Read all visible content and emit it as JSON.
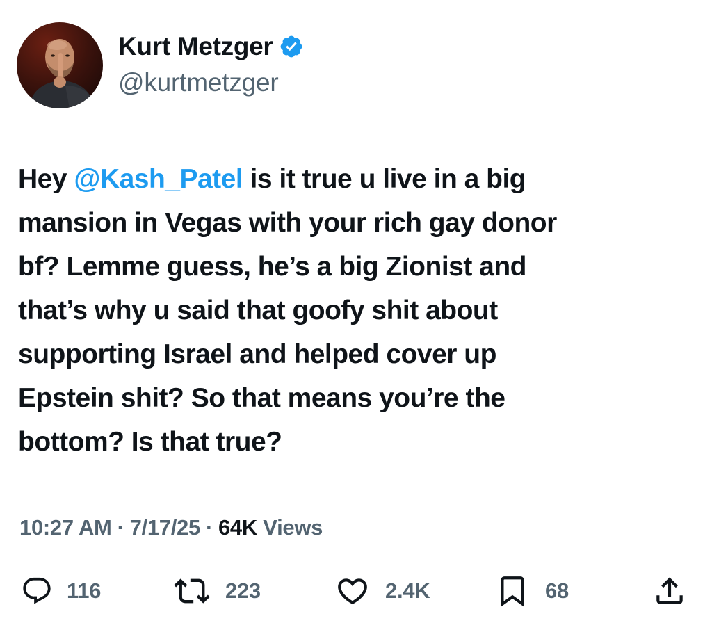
{
  "author": {
    "display_name": "Kurt Metzger",
    "handle": "@kurtmetzger",
    "verified": true,
    "verified_icon": "verified-badge-icon",
    "verified_color": "#1d9bf0"
  },
  "tweet": {
    "text_segments": [
      {
        "type": "text",
        "value": "Hey "
      },
      {
        "type": "mention",
        "value": "@Kash_Patel"
      },
      {
        "type": "text",
        "value": " is it true u live in a big\nmansion in Vegas with your rich gay donor\nbf? Lemme guess, he’s a big Zionist and\nthat’s why u said that goofy shit about\nsupporting Israel and helped cover up\nEpstein shit? So that means you’re the\nbottom? Is that true?"
      }
    ],
    "mention_color": "#1d9bf0"
  },
  "meta": {
    "time": "10:27 AM",
    "separator": "·",
    "date": "7/17/25",
    "views_count": "64K",
    "views_label": "Views"
  },
  "actions": {
    "replies": {
      "icon": "reply-icon",
      "count": "116"
    },
    "reposts": {
      "icon": "repost-icon",
      "count": "223"
    },
    "likes": {
      "icon": "heart-icon",
      "count": "2.4K"
    },
    "bookmarks": {
      "icon": "bookmark-icon",
      "count": "68"
    },
    "share": {
      "icon": "share-icon"
    }
  },
  "colors": {
    "text_primary": "#0f1419",
    "text_secondary": "#536471",
    "accent": "#1d9bf0",
    "background": "#ffffff"
  }
}
